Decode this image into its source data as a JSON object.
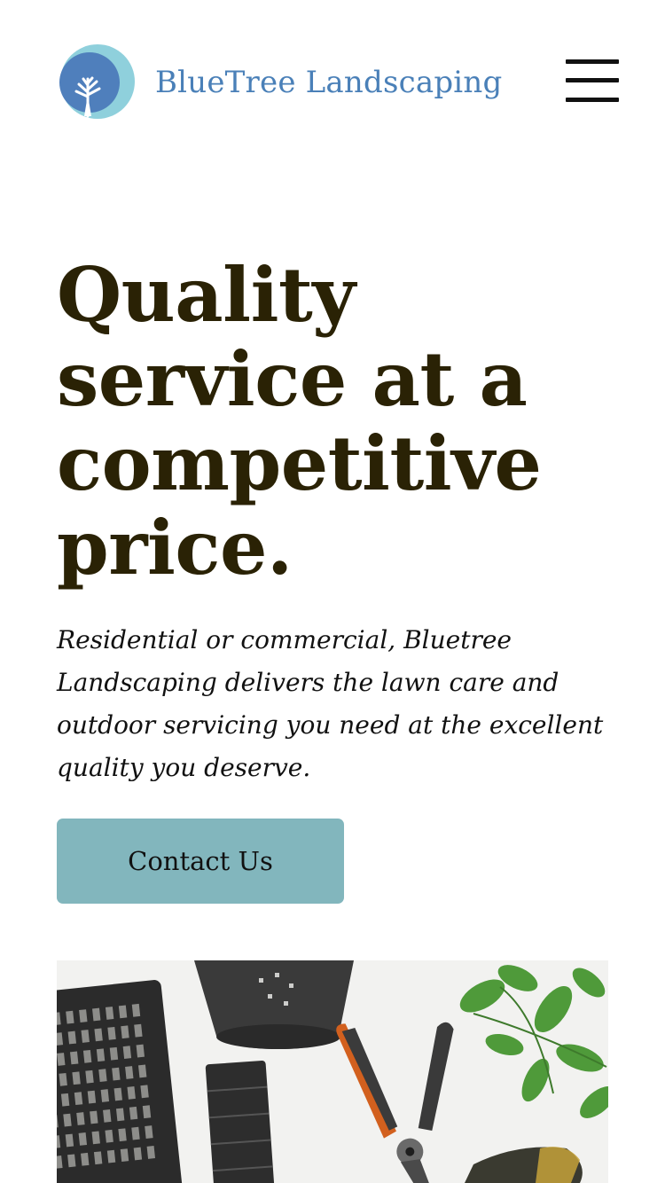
{
  "header": {
    "brand_name": "BlueTree Landscaping",
    "logo_icon": "bluetree-logo-icon",
    "menu_icon": "hamburger-menu-icon"
  },
  "hero": {
    "title": "Quality service at a competitive price.",
    "description": "Residential or commercial, Bluetree Landscaping delivers the lawn care and outdoor servicing you need at the excellent quality you deserve.",
    "cta_label": "Contact Us",
    "photo": "gardening-tools-photo"
  },
  "colors": {
    "brand_blue": "#4a80b8",
    "logo_light": "#8fd0dc",
    "logo_dark": "#4f7fbc",
    "heading": "#2a2205",
    "button": "#82b6bd"
  }
}
